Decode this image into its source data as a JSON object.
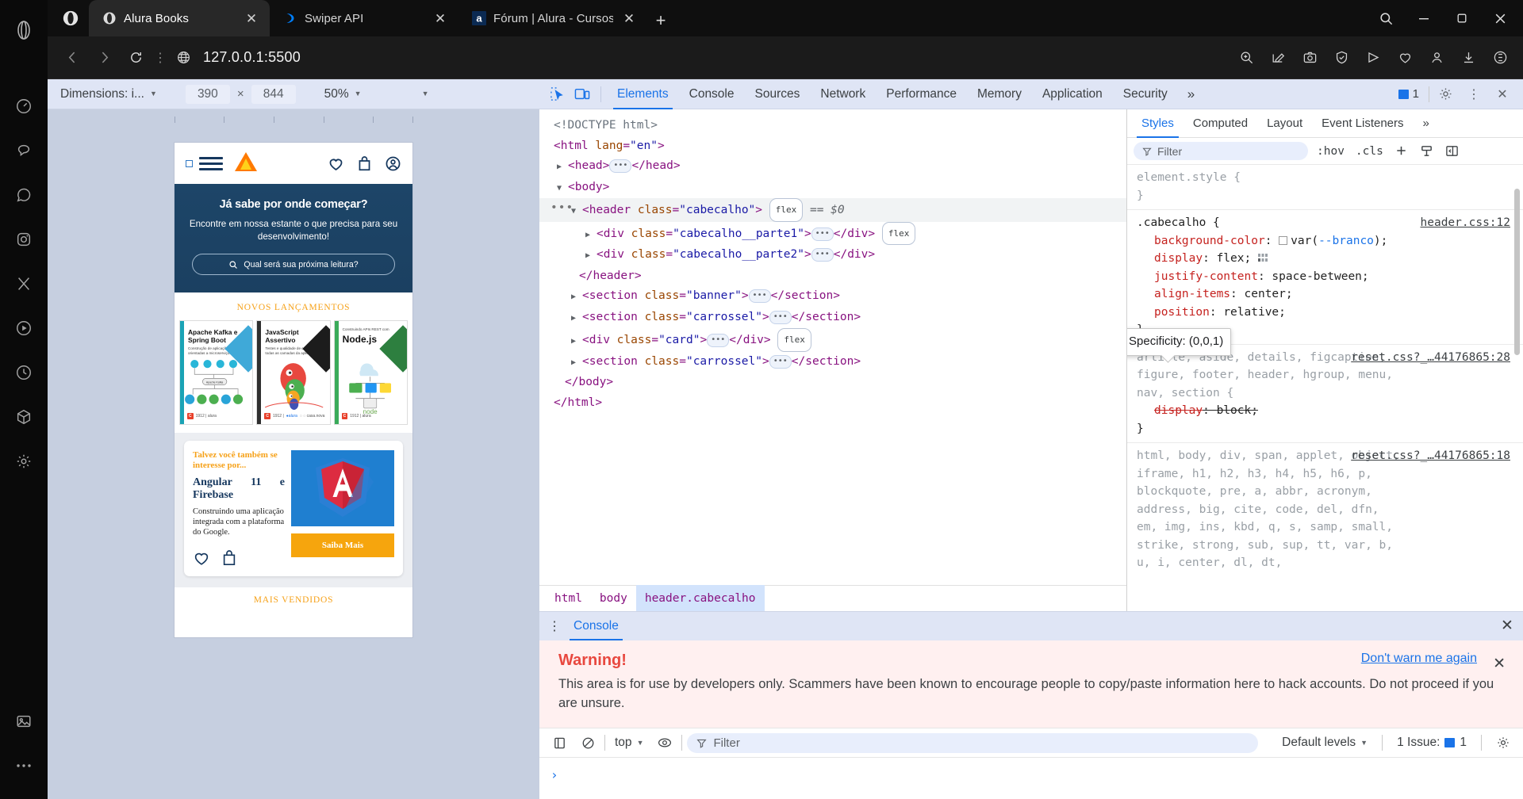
{
  "browser": {
    "tabs": [
      {
        "title": "Alura Books",
        "favicon": "opera-icon",
        "active": true
      },
      {
        "title": "Swiper API",
        "favicon": "swiper-icon",
        "active": false
      },
      {
        "title": "Fórum | Alura - Cursos onli",
        "favicon": "alura-icon",
        "active": false
      }
    ],
    "new_tab_label": "+",
    "close_label": "✕",
    "address": {
      "url": "127.0.0.1:5500",
      "back_label": "‹",
      "forward_label": "›",
      "reload_label": "↻",
      "menu_label": "⋮"
    },
    "window_controls": {
      "minimize": "—",
      "maximize": "❐",
      "close": "✕"
    },
    "search_label": "search-icon"
  },
  "device_toolbar": {
    "dimensions_label": "Dimensions: i...",
    "width": "390",
    "times": "×",
    "height": "844",
    "zoom": "50%",
    "caret": "▼"
  },
  "devtools": {
    "tabs": [
      "Elements",
      "Console",
      "Sources",
      "Network",
      "Performance",
      "Memory",
      "Application",
      "Security"
    ],
    "active_tab": "Elements",
    "more_label": "»",
    "issues_count": "1",
    "settings_label": "gear-icon",
    "dots_label": "⋮",
    "close_label": "✕"
  },
  "dom_tree": [
    {
      "indent": 0,
      "tri": "",
      "text": "<!DOCTYPE html>",
      "kind": "doctype"
    },
    {
      "indent": 0,
      "tri": "",
      "text": "<html lang=\"en\">",
      "kind": "open_attr",
      "tag": "html",
      "attr": "lang",
      "value": "\"en\""
    },
    {
      "indent": 0,
      "tri": "▶",
      "tag": "head",
      "kind": "collapsed"
    },
    {
      "indent": 0,
      "tri": "▼",
      "tag": "body",
      "kind": "open"
    },
    {
      "indent": 1,
      "tri": "▼",
      "tag": "header",
      "attr": "class",
      "value": "\"cabecalho\"",
      "kind": "open_attr_badge",
      "badge": "flex",
      "suffix": "== $0",
      "selected": true
    },
    {
      "indent": 2,
      "tri": "▶",
      "tag": "div",
      "attr": "class",
      "value": "\"cabecalho__parte1\"",
      "kind": "collapsed_attr_badge",
      "badge": "flex"
    },
    {
      "indent": 2,
      "tri": "▶",
      "tag": "div",
      "attr": "class",
      "value": "\"cabecalho__parte2\"",
      "kind": "collapsed_attr"
    },
    {
      "indent": 1,
      "tri": "",
      "tag": "header",
      "kind": "close"
    },
    {
      "indent": 1,
      "tri": "▶",
      "tag": "section",
      "attr": "class",
      "value": "\"banner\"",
      "kind": "collapsed_attr"
    },
    {
      "indent": 1,
      "tri": "▶",
      "tag": "section",
      "attr": "class",
      "value": "\"carrossel\"",
      "kind": "collapsed_attr"
    },
    {
      "indent": 1,
      "tri": "▶",
      "tag": "div",
      "attr": "class",
      "value": "\"card\"",
      "kind": "collapsed_attr_badge",
      "badge": "flex"
    },
    {
      "indent": 1,
      "tri": "▶",
      "tag": "section",
      "attr": "class",
      "value": "\"carrossel\"",
      "kind": "collapsed_attr"
    },
    {
      "indent": 0,
      "tri": "",
      "tag": "body",
      "kind": "close"
    },
    {
      "indent": -1,
      "tri": "",
      "tag": "html",
      "kind": "close"
    }
  ],
  "breadcrumbs": [
    "html",
    "body",
    "header.cabecalho"
  ],
  "styles": {
    "tabs": [
      "Styles",
      "Computed",
      "Layout",
      "Event Listeners"
    ],
    "active_tab": "Styles",
    "more_label": "»",
    "filter_placeholder": "Filter",
    "hov_label": ":hov",
    "cls_label": ".cls",
    "plus_label": "+",
    "tooltip": "Specificity: (0,0,1)",
    "rules": [
      {
        "selector": "element.style {",
        "source": "",
        "declarations": [],
        "closing": "}"
      },
      {
        "selector": ".cabecalho {",
        "source": "header.css:12",
        "declarations": [
          {
            "prop": "background-color",
            "value": "var(--branco);",
            "swatch": true,
            "var": true
          },
          {
            "prop": "display",
            "value": "flex;",
            "grid": true
          },
          {
            "prop": "justify-content",
            "value": "space-between;"
          },
          {
            "prop": "align-items",
            "value": "center;"
          },
          {
            "prop": "position",
            "value": "relative;"
          }
        ],
        "closing": "}"
      },
      {
        "selector": "article, aside, details, figcaption, figure, footer, header, hgroup, menu, nav, section {",
        "source": "reset.css?_…44176865:28",
        "declarations": [
          {
            "prop": "display",
            "value": "block;",
            "struck": true
          }
        ],
        "closing": "}"
      },
      {
        "selector": "html, body, div, span, applet, object, iframe, h1, h2, h3, h4, h5, h6, p, blockquote, pre, a, abbr, acronym, address, big, cite, code, del, dfn, em, img, ins, kbd, q, s, samp, small, strike, strong, sub, sup, tt, var, b, u, i, center, dl, dt,",
        "source": "reset.css?_…44176865:18",
        "declarations": [],
        "closing": ""
      }
    ]
  },
  "console_drawer": {
    "tab_label": "Console",
    "dots_label": "⋮",
    "close_label": "✕",
    "warning_title": "Warning!",
    "warning_text": "This area is for use by developers only. Scammers have been known to encourage people to copy/paste information here to hack accounts. Do not proceed if you are unsure.",
    "dont_warn_label": "Don't warn me again",
    "dismiss_label": "✕",
    "context": "top",
    "filter_placeholder": "Filter",
    "levels": "Default levels",
    "issues_label": "1 Issue:",
    "issues_count": "1",
    "prompt": "›"
  },
  "page_preview": {
    "header": {
      "menu_label": "menu-icon",
      "logo_label": "alura-logo",
      "icons": [
        "heart-icon",
        "bag-icon",
        "account-icon"
      ]
    },
    "banner": {
      "heading": "Já sabe por onde começar?",
      "subheading": "Encontre em nossa estante o que precisa para seu desenvolvimento!",
      "search_placeholder": "Qual será sua próxima leitura?"
    },
    "section_title": "NOVOS LANÇAMENTOS",
    "books": [
      {
        "title": "Apache Kafka e Spring Boot",
        "subtitle": "Construção de aplicações orientadas a microserviços",
        "spine": "#1aa3b5",
        "corner": "#3fa9d8"
      },
      {
        "title": "JavaScript Assertivo",
        "subtitle": "Testes e qualidade de código em todas as camadas da aplicação",
        "spine": "#2f2f2f",
        "corner": "#1c1c1c"
      },
      {
        "title": "Node.js",
        "subtitle": "Construindo APIs REST com",
        "spine": "#3aab5a",
        "corner": "#2d7f3f"
      }
    ],
    "promo": {
      "kicker": "Talvez você também se interesse por...",
      "title_line1": "Angular",
      "title_num": "11",
      "title_e": "e",
      "title_line2": "Firebase",
      "description": "Construindo uma aplicação integrada com a plataforma do Google.",
      "button": "Saiba Mais",
      "icons": [
        "heart-icon",
        "bag-icon"
      ]
    },
    "section_title2": "MAIS VENDIDOS"
  },
  "colors": {
    "accent_blue": "#1a73e8",
    "warn_red": "#e8483f",
    "alura_orange": "#f6a118",
    "alura_navy": "#15375e"
  }
}
